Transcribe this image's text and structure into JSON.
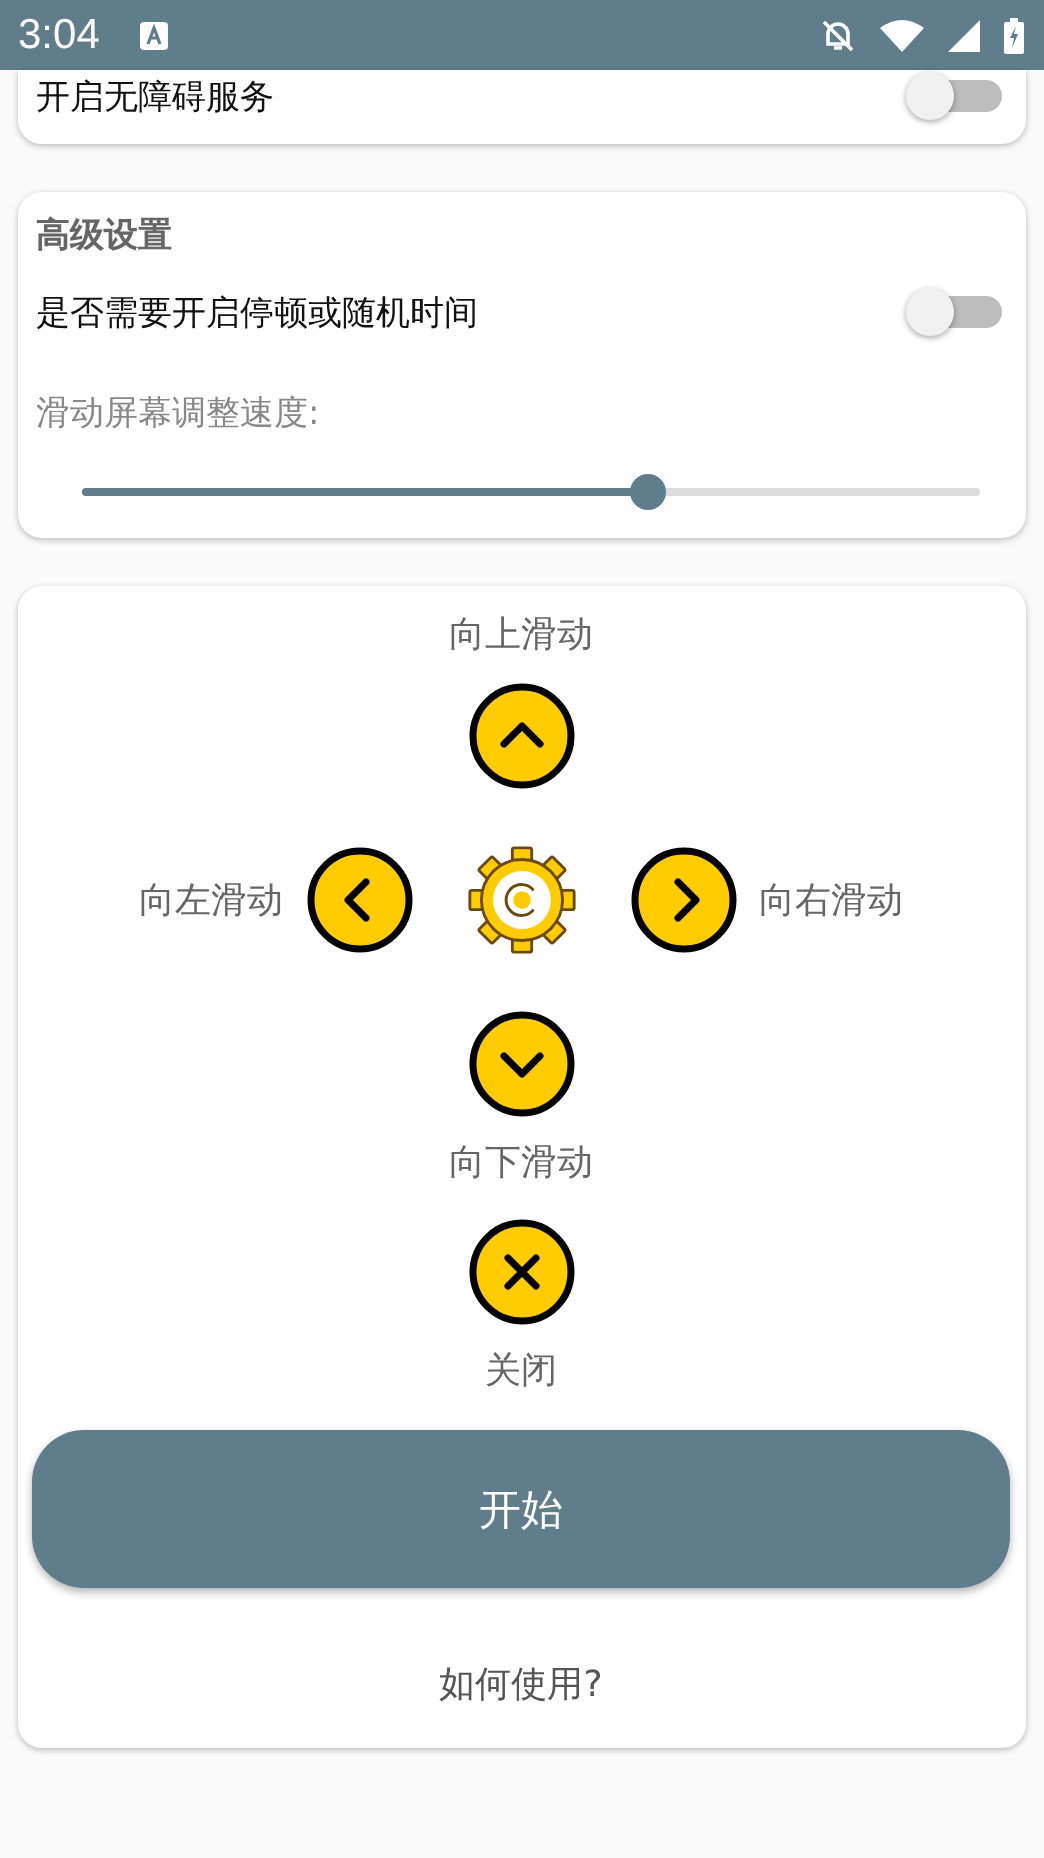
{
  "status_bar": {
    "time": "3:04"
  },
  "accessibility_card": {
    "label": "开启无障碍服务",
    "on": false
  },
  "advanced_card": {
    "title": "高级设置",
    "pause_toggle": {
      "label": "是否需要开启停顿或随机时间",
      "on": false
    },
    "speed_label": "滑动屏幕调整速度:",
    "speed_slider": {
      "level": 0.63
    }
  },
  "controls_card": {
    "up": "向上滑动",
    "left": "向左滑动",
    "right": "向右滑动",
    "down": "向下滑动",
    "close": "关闭",
    "start_button": "开始",
    "help_link": "如何使用?"
  }
}
